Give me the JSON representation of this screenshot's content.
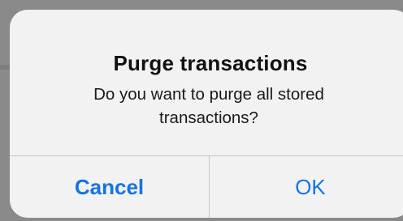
{
  "alert": {
    "title": "Purge transactions",
    "message": "Do you want to purge all stored transactions?",
    "buttons": {
      "cancel_label": "Cancel",
      "ok_label": "OK"
    },
    "accent_color": "#1474e6"
  }
}
